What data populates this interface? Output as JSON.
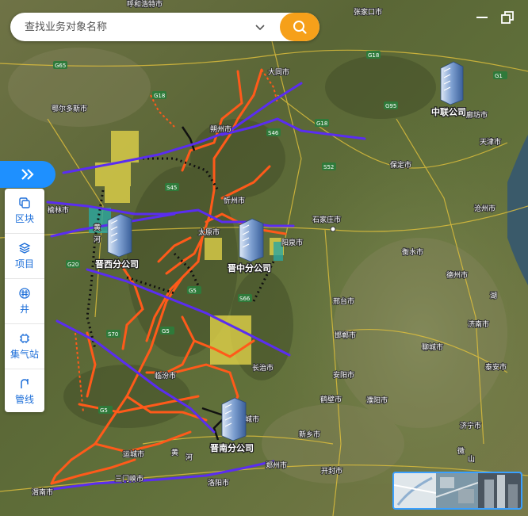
{
  "search": {
    "placeholder": "查找业务对象名称"
  },
  "icons": {
    "dropdown": "chevron-down-icon",
    "search": "search-icon",
    "minimize": "minimize-icon",
    "restore": "restore-window-icon",
    "expand": "double-chevron-right-icon"
  },
  "sidebar": {
    "items": [
      {
        "label": "区块",
        "icon": "copy-icon"
      },
      {
        "label": "项目",
        "icon": "layers-icon"
      },
      {
        "label": "井",
        "icon": "well-icon"
      },
      {
        "label": "集气站",
        "icon": "chip-icon"
      },
      {
        "label": "管线",
        "icon": "pipeline-icon"
      }
    ]
  },
  "companies": [
    {
      "name": "中联公司"
    },
    {
      "name": "晋西分公司"
    },
    {
      "name": "晋中分公司"
    },
    {
      "name": "晋南分公司"
    }
  ],
  "cities": [
    "鄂尔多斯市",
    "榆林市",
    "大同市",
    "朔州市",
    "忻州市",
    "太原市",
    "阳泉市",
    "石家庄市",
    "保定市",
    "天津市",
    "沧州市",
    "衡水市",
    "德州市",
    "邢台市",
    "邯郸市",
    "长治市",
    "安阳市",
    "聊城市",
    "济南市",
    "泰安市",
    "临汾市",
    "鹤壁市",
    "濮阳市",
    "新乡市",
    "晋城市",
    "济宁市",
    "运城市",
    "三门峡市",
    "洛阳市",
    "郑州市",
    "开封市",
    "渭南市",
    "廊坊市",
    "张家口市",
    "呼和浩特市"
  ],
  "roads": [
    "G65",
    "G18",
    "S46",
    "G95",
    "G18",
    "S52",
    "G18",
    "S45",
    "G20",
    "G5",
    "S66",
    "S70",
    "G5",
    "G1",
    "G5"
  ],
  "rivers": [
    "黄",
    "河",
    "黄",
    "河",
    "微",
    "山",
    "湖"
  ],
  "colors": {
    "accent": "#1e90ff",
    "search_button": "#f6a01a",
    "pipeline_blue": "#5a2df0",
    "pipeline_orange": "#ff5a1a",
    "block_yellow": "#e8d84a"
  }
}
